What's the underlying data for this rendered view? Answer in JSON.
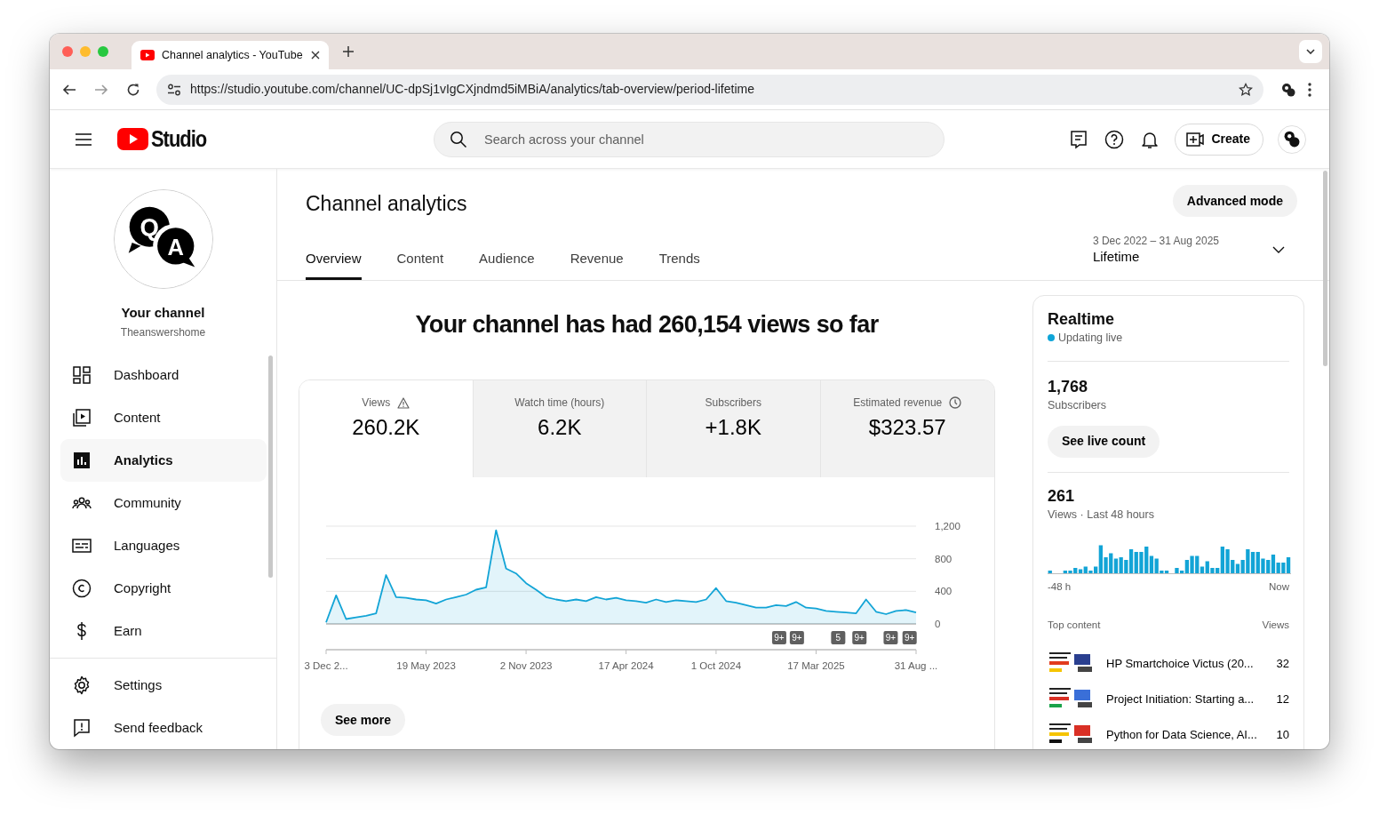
{
  "browser": {
    "tab_title": "Channel analytics - YouTube",
    "url": "https://studio.youtube.com/channel/UC-dpSj1vIgCXjndmd5iMBiA/analytics/tab-overview/period-lifetime"
  },
  "header": {
    "logo_text": "Studio",
    "search": {
      "placeholder": "Search across your channel"
    },
    "create_label": "Create"
  },
  "sidebar": {
    "avatar_letters": [
      "Q",
      "A"
    ],
    "channel_title": "Your channel",
    "channel_handle": "Theanswershome",
    "items": [
      {
        "label": "Dashboard",
        "selected": false
      },
      {
        "label": "Content",
        "selected": false
      },
      {
        "label": "Analytics",
        "selected": true
      },
      {
        "label": "Community",
        "selected": false
      },
      {
        "label": "Languages",
        "selected": false
      },
      {
        "label": "Copyright",
        "selected": false
      },
      {
        "label": "Earn",
        "selected": false
      }
    ],
    "footer_items": [
      {
        "label": "Settings"
      },
      {
        "label": "Send feedback"
      }
    ]
  },
  "page": {
    "title": "Channel analytics",
    "advanced_button": "Advanced mode",
    "tabs": [
      {
        "label": "Overview",
        "selected": true
      },
      {
        "label": "Content",
        "selected": false
      },
      {
        "label": "Audience",
        "selected": false
      },
      {
        "label": "Revenue",
        "selected": false
      },
      {
        "label": "Trends",
        "selected": false
      }
    ],
    "period": {
      "range": "3 Dec 2022 – 31 Aug 2025",
      "label": "Lifetime"
    }
  },
  "overview": {
    "headline": "Your channel has had 260,154 views so far",
    "metrics": [
      {
        "label": "Views",
        "value": "260.2K",
        "selected": true
      },
      {
        "label": "Watch time (hours)",
        "value": "6.2K",
        "selected": false
      },
      {
        "label": "Subscribers",
        "value": "+1.8K",
        "selected": false
      },
      {
        "label": "Estimated revenue",
        "value": "$323.57",
        "selected": false
      }
    ],
    "chart_data": {
      "type": "area",
      "ylim": [
        0,
        1200
      ],
      "yticks": [
        0,
        400,
        800,
        {
          "value": 1200,
          "label": "1,200"
        }
      ],
      "categories": [
        "3 Dec 2...",
        null,
        null,
        null,
        null,
        null,
        null,
        null,
        null,
        null,
        "19 May 2023",
        null,
        null,
        null,
        null,
        null,
        null,
        null,
        null,
        null,
        "2 Nov 2023",
        null,
        null,
        null,
        null,
        null,
        null,
        null,
        null,
        null,
        "17 Apr 2024",
        null,
        null,
        null,
        null,
        null,
        null,
        null,
        null,
        "1 Oct 2024",
        null,
        null,
        null,
        null,
        null,
        null,
        null,
        null,
        null,
        "17 Mar 2025",
        null,
        null,
        null,
        null,
        null,
        null,
        null,
        null,
        null,
        "31 Aug ..."
      ],
      "series": [
        {
          "color": "#12a4d6",
          "values": [
            20,
            350,
            60,
            80,
            100,
            130,
            600,
            330,
            320,
            300,
            290,
            250,
            300,
            330,
            360,
            420,
            450,
            1150,
            680,
            620,
            500,
            420,
            330,
            300,
            280,
            300,
            280,
            330,
            300,
            320,
            290,
            280,
            260,
            300,
            270,
            290,
            280,
            270,
            300,
            440,
            280,
            260,
            230,
            200,
            200,
            230,
            220,
            270,
            200,
            190,
            160,
            150,
            140,
            130,
            300,
            150,
            120,
            160,
            170,
            140
          ]
        }
      ],
      "annotations": [
        "9+",
        "9+",
        "5",
        "9+",
        "9+",
        "9+"
      ]
    },
    "see_more": "See more"
  },
  "realtime": {
    "title": "Realtime",
    "status": "Updating live",
    "subscribers": "1,768",
    "subscribers_label": "Subscribers",
    "live_button": "See live count",
    "views": "261",
    "views_label": "Views · Last 48 hours",
    "axis_start": "-48 h",
    "axis_end": "Now",
    "top_label": "Top content",
    "views_heading": "Views",
    "top_content": [
      {
        "title": "HP Smartchoice Victus (20...",
        "views": "32"
      },
      {
        "title": "Project Initiation: Starting a...",
        "views": "12"
      },
      {
        "title": "Python for Data Science, AI...",
        "views": "10"
      }
    ]
  }
}
